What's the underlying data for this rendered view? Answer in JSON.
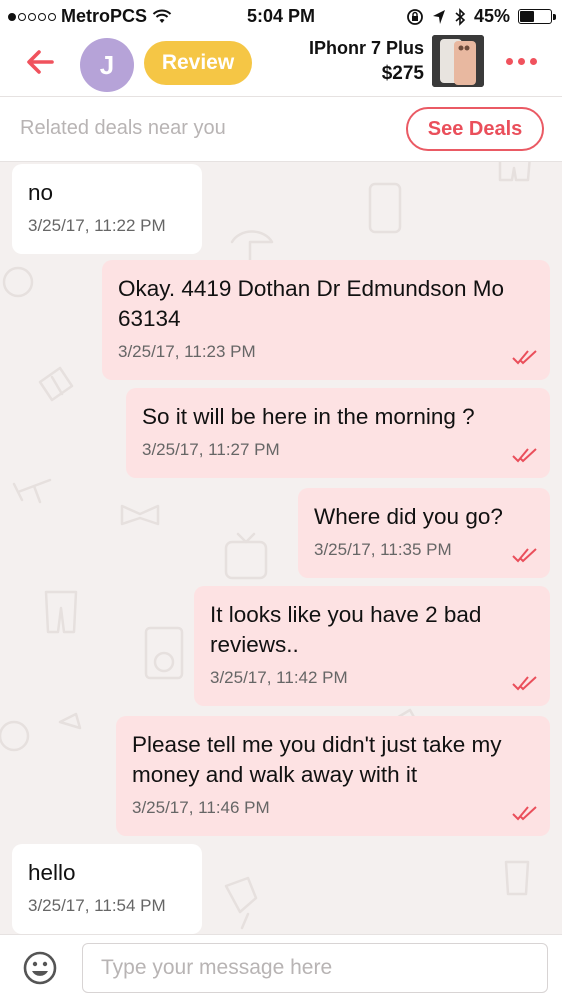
{
  "status_bar": {
    "carrier": "MetroPCS",
    "time": "5:04 PM",
    "battery": "45%",
    "battery_level": 0.45
  },
  "header": {
    "avatar_initial": "J",
    "review_label": "Review",
    "item_name": "IPhonr 7 Plus",
    "item_price": "$275"
  },
  "deals": {
    "text": "Related deals near you",
    "button_label": "See Deals"
  },
  "messages": [
    {
      "direction": "in",
      "text": "no",
      "time": "3/25/17, 11:22 PM"
    },
    {
      "direction": "out",
      "text": "Okay. 4419 Dothan Dr Edmundson Mo 63134",
      "time": "3/25/17, 11:23 PM"
    },
    {
      "direction": "out",
      "text": "So it will be here in the morning ?",
      "time": "3/25/17, 11:27 PM"
    },
    {
      "direction": "out",
      "text": "Where did you go?",
      "time": "3/25/17, 11:35 PM"
    },
    {
      "direction": "out",
      "text": "It looks like you have 2 bad reviews..",
      "time": "3/25/17, 11:42 PM"
    },
    {
      "direction": "out",
      "text": "Please tell me you didn't just take my money and walk away with it",
      "time": "3/25/17, 11:46 PM"
    },
    {
      "direction": "in",
      "text": "hello",
      "time": "3/25/17, 11:54 PM"
    }
  ],
  "composer": {
    "placeholder": "Type your message here"
  },
  "colors": {
    "accent": "#f0525d",
    "review_badge": "#f5c645",
    "avatar": "#b6a3d8",
    "outgoing_bubble": "#fde2e3",
    "incoming_bubble": "#ffffff"
  },
  "icons": [
    "back-arrow-icon",
    "more-icon",
    "double-check-icon",
    "emoji-icon"
  ]
}
